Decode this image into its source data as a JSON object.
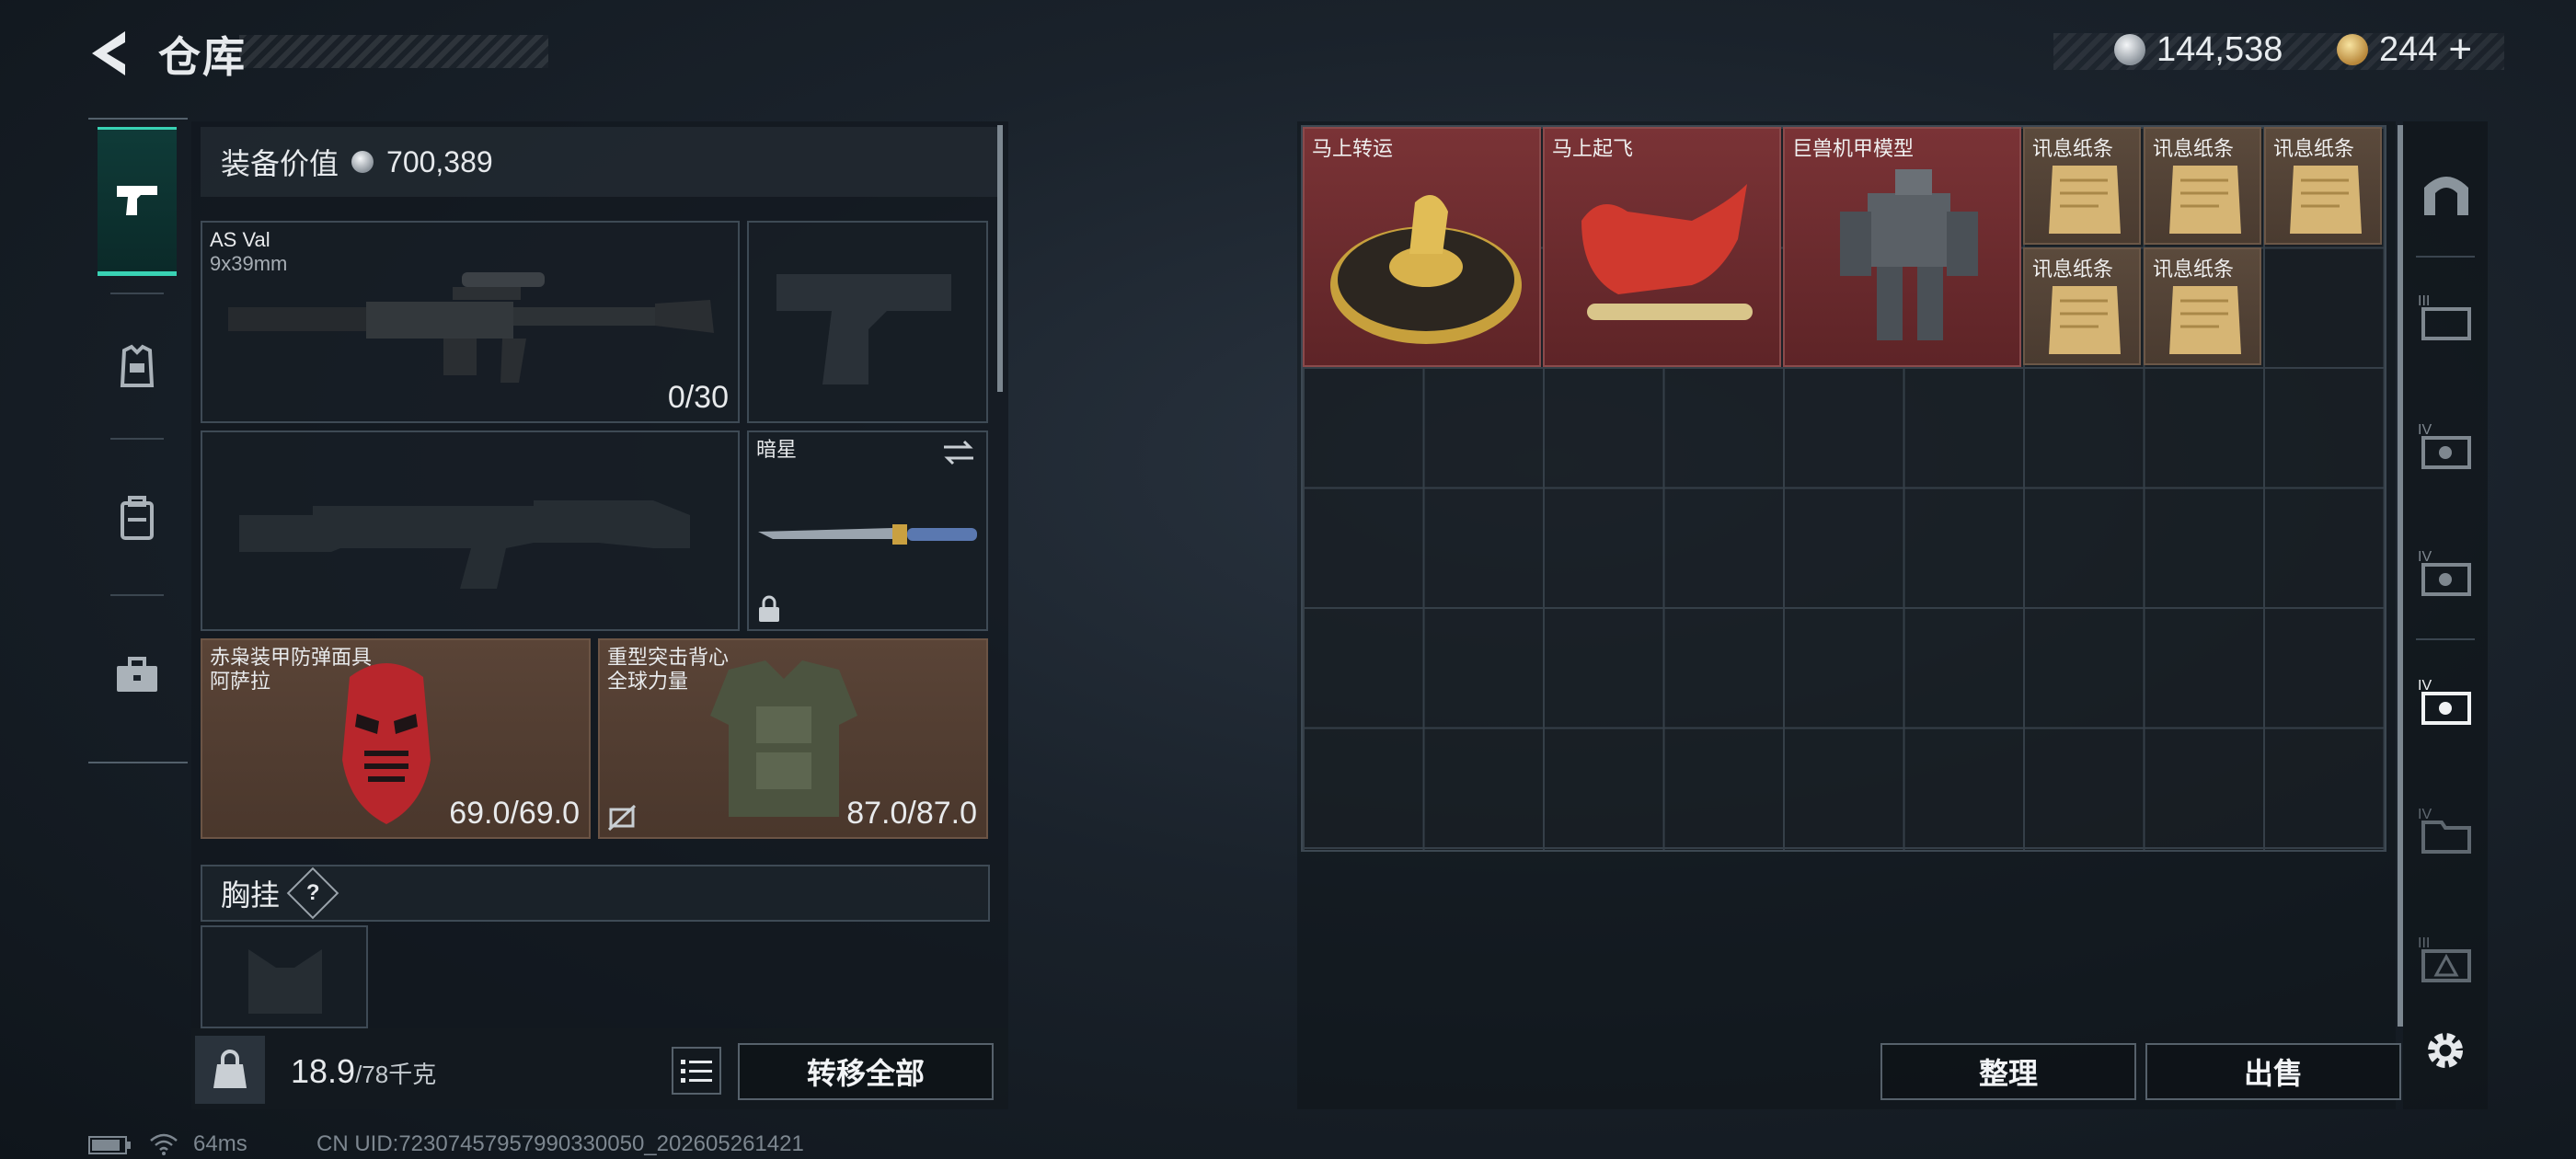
{
  "header": {
    "title": "仓库",
    "currency_silver": "144,538",
    "currency_gold": "244",
    "add_symbol": "+"
  },
  "left_rail": {
    "items": [
      {
        "name": "weapons",
        "icon": "pistol-icon",
        "active": true
      },
      {
        "name": "armor",
        "icon": "armor-vest-icon",
        "active": false
      },
      {
        "name": "backpack",
        "icon": "backpack-icon",
        "active": false
      },
      {
        "name": "tools",
        "icon": "toolbox-icon",
        "active": false
      }
    ]
  },
  "equipment": {
    "value_label": "装备价值",
    "value": "700,389",
    "primary": {
      "name": "AS Val",
      "caliber": "9x39mm",
      "ammo": "0/30"
    },
    "melee": {
      "name": "暗星"
    },
    "helmet": {
      "name": "赤枭装甲防弹面具",
      "brand": "阿萨拉",
      "durability": "69.0/69.0"
    },
    "vest": {
      "name": "重型突击背心",
      "brand": "全球力量",
      "durability": "87.0/87.0"
    },
    "chest_rig": {
      "label": "胸挂",
      "help": "?"
    }
  },
  "bottom_bar": {
    "weight_current": "18.9",
    "weight_max": "/78千克",
    "transfer_all": "转移全部",
    "organize": "整理",
    "sell": "出售"
  },
  "storage_items": [
    {
      "name": "马上转运",
      "color": "red",
      "icon": "horse-coin-icon"
    },
    {
      "name": "马上起飞",
      "color": "red",
      "icon": "red-horse-icon"
    },
    {
      "name": "巨兽机甲模型",
      "color": "red",
      "icon": "mech-model-icon"
    },
    {
      "name": "讯息纸条",
      "color": "tan",
      "icon": "paper-note-icon"
    },
    {
      "name": "讯息纸条",
      "color": "tan",
      "icon": "paper-note-icon"
    },
    {
      "name": "讯息纸条",
      "color": "tan",
      "icon": "paper-note-icon"
    },
    {
      "name": "讯息纸条",
      "color": "tan",
      "icon": "paper-note-icon"
    },
    {
      "name": "讯息纸条",
      "color": "tan",
      "icon": "paper-note-icon"
    }
  ],
  "storage_grid": {
    "columns": 9,
    "rows": 6
  },
  "filters": [
    "all-storage",
    "tier3-storage",
    "tier4-storage-a",
    "tier4-storage-b",
    "tier4-storage-active",
    "tier4-storage-c",
    "tier3-storage-b"
  ],
  "footer": {
    "ping": "64ms",
    "uid": "CN UID:72307457957990330050_202605261421"
  },
  "colors": {
    "accent": "#39d2b4",
    "rare_red": "#7a3336",
    "item_tan": "#5b4a3c"
  }
}
